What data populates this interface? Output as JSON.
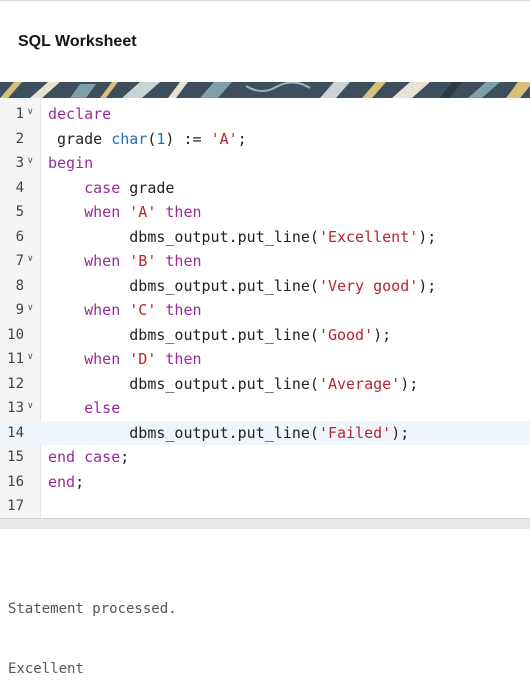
{
  "header": {
    "title": "SQL Worksheet"
  },
  "editor": {
    "active_line": 14,
    "lines": [
      {
        "num": "1",
        "fold": true,
        "tokens": [
          {
            "t": "declare",
            "c": "kw"
          }
        ]
      },
      {
        "num": "2",
        "fold": false,
        "tokens": [
          {
            "t": " grade ",
            "c": ""
          },
          {
            "t": "char",
            "c": "fn"
          },
          {
            "t": "(",
            "c": ""
          },
          {
            "t": "1",
            "c": "num"
          },
          {
            "t": ") := ",
            "c": ""
          },
          {
            "t": "'A'",
            "c": "str"
          },
          {
            "t": ";",
            "c": ""
          }
        ]
      },
      {
        "num": "3",
        "fold": true,
        "tokens": [
          {
            "t": "begin",
            "c": "kw"
          }
        ]
      },
      {
        "num": "4",
        "fold": false,
        "tokens": [
          {
            "t": "    ",
            "c": ""
          },
          {
            "t": "case",
            "c": "kw"
          },
          {
            "t": " grade",
            "c": ""
          }
        ]
      },
      {
        "num": "5",
        "fold": false,
        "tokens": [
          {
            "t": "    ",
            "c": ""
          },
          {
            "t": "when",
            "c": "kw"
          },
          {
            "t": " ",
            "c": ""
          },
          {
            "t": "'A'",
            "c": "str"
          },
          {
            "t": " ",
            "c": ""
          },
          {
            "t": "then",
            "c": "kw"
          }
        ]
      },
      {
        "num": "6",
        "fold": false,
        "tokens": [
          {
            "t": "         dbms_output.put_line(",
            "c": ""
          },
          {
            "t": "'Excellent'",
            "c": "str"
          },
          {
            "t": ");",
            "c": ""
          }
        ]
      },
      {
        "num": "7",
        "fold": true,
        "tokens": [
          {
            "t": "    ",
            "c": ""
          },
          {
            "t": "when",
            "c": "kw"
          },
          {
            "t": " ",
            "c": ""
          },
          {
            "t": "'B'",
            "c": "str"
          },
          {
            "t": " ",
            "c": ""
          },
          {
            "t": "then",
            "c": "kw"
          }
        ]
      },
      {
        "num": "8",
        "fold": false,
        "tokens": [
          {
            "t": "         dbms_output.put_line(",
            "c": ""
          },
          {
            "t": "'Very good'",
            "c": "str"
          },
          {
            "t": ");",
            "c": ""
          }
        ]
      },
      {
        "num": "9",
        "fold": true,
        "tokens": [
          {
            "t": "    ",
            "c": ""
          },
          {
            "t": "when",
            "c": "kw"
          },
          {
            "t": " ",
            "c": ""
          },
          {
            "t": "'C'",
            "c": "str"
          },
          {
            "t": " ",
            "c": ""
          },
          {
            "t": "then",
            "c": "kw"
          }
        ]
      },
      {
        "num": "10",
        "fold": false,
        "tokens": [
          {
            "t": "         dbms_output.put_line(",
            "c": ""
          },
          {
            "t": "'Good'",
            "c": "str"
          },
          {
            "t": ");",
            "c": ""
          }
        ]
      },
      {
        "num": "11",
        "fold": true,
        "tokens": [
          {
            "t": "    ",
            "c": ""
          },
          {
            "t": "when",
            "c": "kw"
          },
          {
            "t": " ",
            "c": ""
          },
          {
            "t": "'D'",
            "c": "str"
          },
          {
            "t": " ",
            "c": ""
          },
          {
            "t": "then",
            "c": "kw"
          }
        ]
      },
      {
        "num": "12",
        "fold": false,
        "tokens": [
          {
            "t": "         dbms_output.put_line(",
            "c": ""
          },
          {
            "t": "'Average'",
            "c": "str"
          },
          {
            "t": ");",
            "c": ""
          }
        ]
      },
      {
        "num": "13",
        "fold": true,
        "tokens": [
          {
            "t": "    ",
            "c": ""
          },
          {
            "t": "else",
            "c": "kw"
          }
        ]
      },
      {
        "num": "14",
        "fold": false,
        "tokens": [
          {
            "t": "         dbms_output.put_line(",
            "c": ""
          },
          {
            "t": "'Failed'",
            "c": "str"
          },
          {
            "t": ");",
            "c": ""
          }
        ]
      },
      {
        "num": "15",
        "fold": false,
        "tokens": [
          {
            "t": "end case",
            "c": "kw"
          },
          {
            "t": ";",
            "c": ""
          }
        ]
      },
      {
        "num": "16",
        "fold": false,
        "tokens": [
          {
            "t": "end",
            "c": "kw"
          },
          {
            "t": ";",
            "c": ""
          }
        ]
      },
      {
        "num": "17",
        "fold": false,
        "tokens": []
      }
    ]
  },
  "output": {
    "lines": [
      "Statement processed.",
      "Excellent"
    ]
  },
  "colors": {
    "keyword": "#9a2a9a",
    "function": "#1f6cbf",
    "string": "#b8232f",
    "active_line": "#eef6fc"
  }
}
